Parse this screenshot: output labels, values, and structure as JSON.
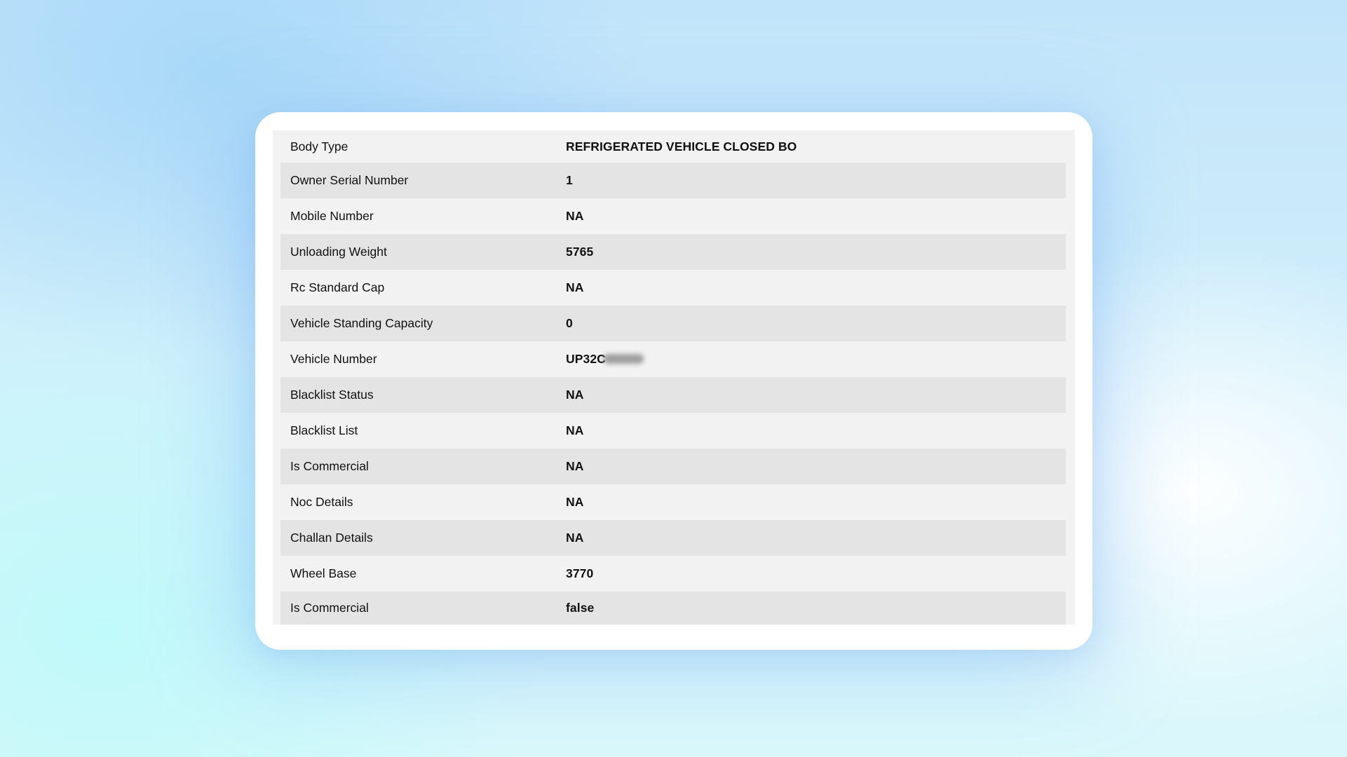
{
  "rows": [
    {
      "label": "Body Type",
      "value": "REFRIGERATED VEHICLE CLOSED BO"
    },
    {
      "label": "Owner Serial Number",
      "value": "1"
    },
    {
      "label": "Mobile Number",
      "value": "NA"
    },
    {
      "label": "Unloading Weight",
      "value": "5765"
    },
    {
      "label": "Rc Standard Cap",
      "value": "NA"
    },
    {
      "label": "Vehicle Standing Capacity",
      "value": "0"
    },
    {
      "label": "Vehicle Number",
      "value": "UP32C"
    },
    {
      "label": "Blacklist Status",
      "value": "NA"
    },
    {
      "label": "Blacklist List",
      "value": "NA"
    },
    {
      "label": "Is Commercial",
      "value": "NA"
    },
    {
      "label": "Noc Details",
      "value": "NA"
    },
    {
      "label": "Challan Details",
      "value": "NA"
    },
    {
      "label": "Wheel Base",
      "value": "3770"
    },
    {
      "label": "Is Commercial",
      "value": "false"
    }
  ],
  "redacted_icon": "blur-redaction"
}
